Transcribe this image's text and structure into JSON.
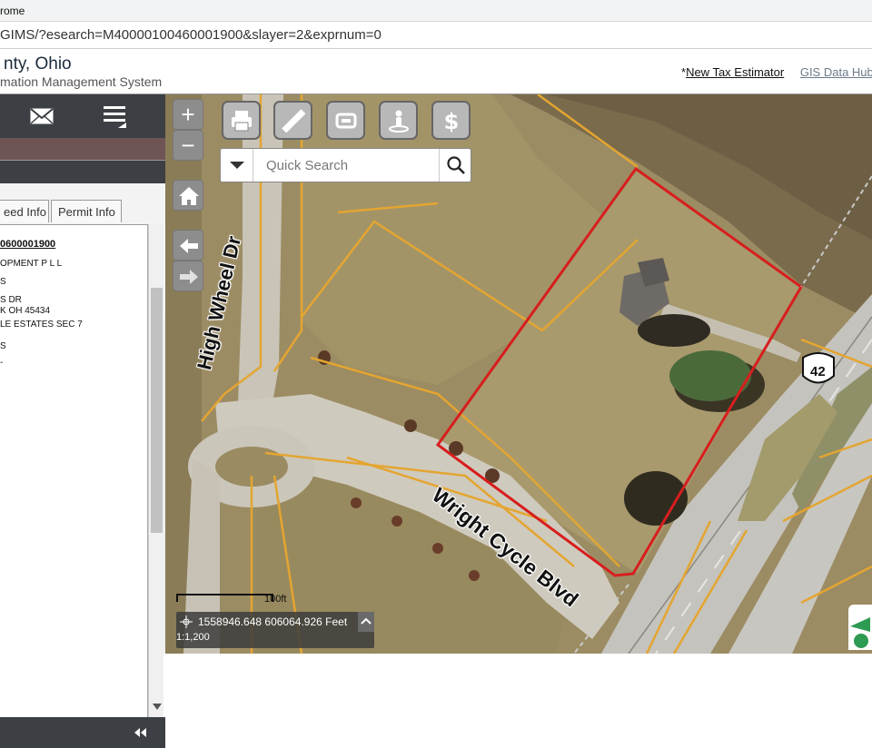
{
  "browser": {
    "title": "rome",
    "url": "GIMS/?esearch=M40000100460001900&slayer=2&exprnum=0"
  },
  "site": {
    "county_title": "nty, Ohio",
    "system_title": "mation Management System",
    "link_tax_prefix": "*",
    "link_tax": "New Tax Estimator",
    "link_gis": "GIS Data Hub"
  },
  "left_panel": {
    "tabs": [
      "eed Info",
      "Permit Info"
    ],
    "parcel_id": "0600001900",
    "details": [
      "OPMENT P L L",
      "S",
      "S DR",
      "K OH 45434",
      "LE ESTATES SEC 7",
      "S",
      "-"
    ]
  },
  "map": {
    "search_placeholder": "Quick Search",
    "scale_label": "100ft",
    "coordinates": "1558946.648 606064.926 Feet",
    "scale_ratio": "1:1,200",
    "labels": {
      "road1": "High Wheel Dr",
      "road2": "Wright Cycle Blvd",
      "route": "42"
    },
    "tools": [
      "printer-icon",
      "ruler-icon",
      "select-icon",
      "person-icon",
      "dollar-icon"
    ],
    "parcel_color": "#d71e1e"
  }
}
